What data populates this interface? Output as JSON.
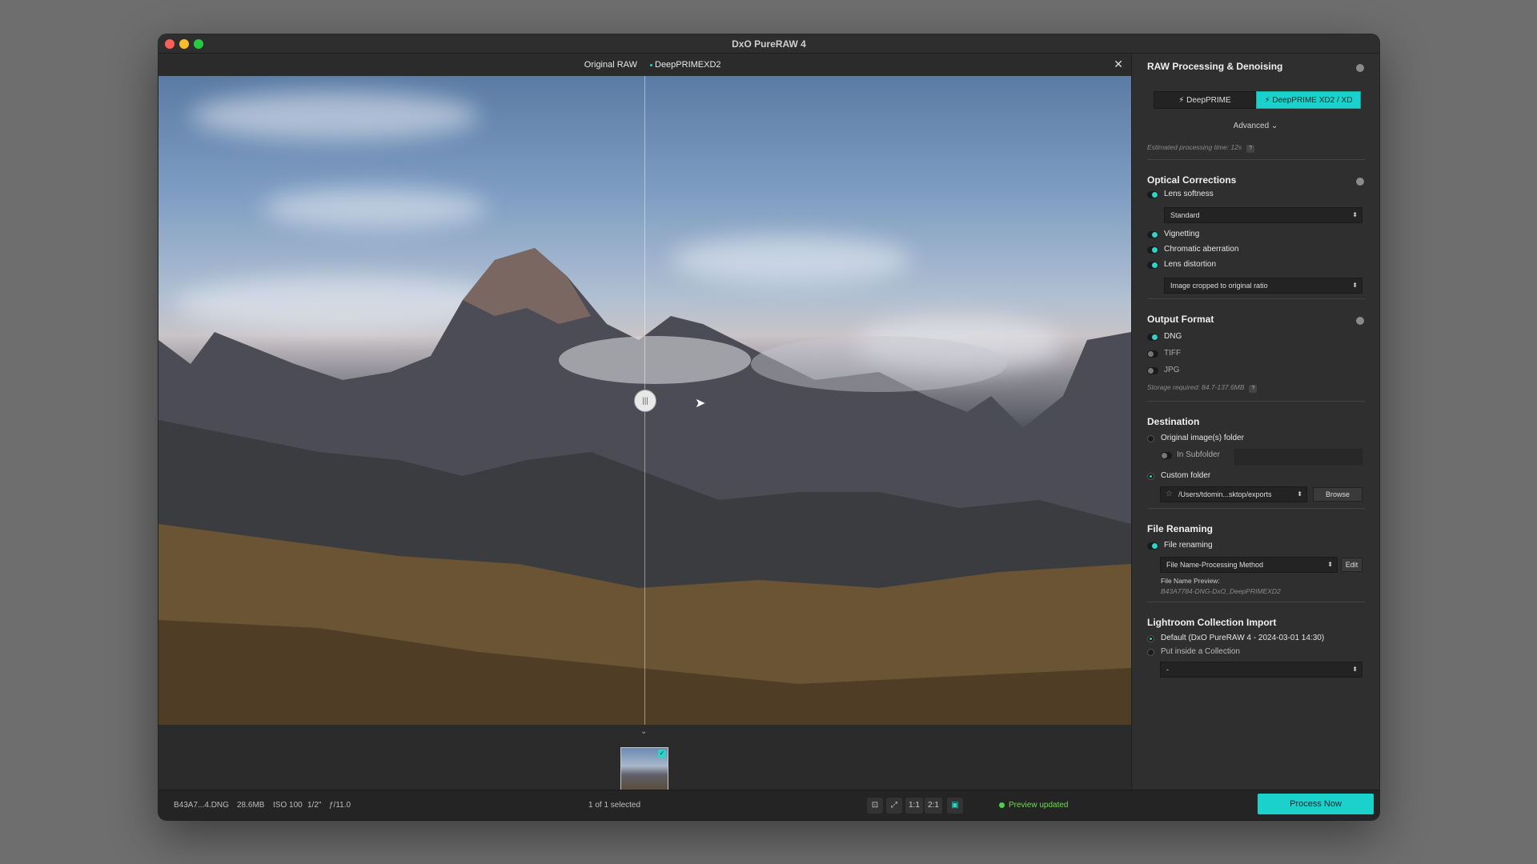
{
  "window": {
    "title": "DxO PureRAW 4"
  },
  "viewer": {
    "compare_left": "Original RAW",
    "compare_right": "DeepPRIMEXD2",
    "close_glyph": "✕",
    "handle_glyph": "|||",
    "expand_glyph": "⌄"
  },
  "filmstrip": {
    "check_glyph": "✓"
  },
  "status": {
    "filename": "B43A7...4.DNG",
    "filesize": "28.6MB",
    "iso": "ISO 100",
    "shutter": "1/2\"",
    "aperture": "ƒ/11.0",
    "selection": "1 of 1 selected",
    "zoom_1": "1:1",
    "zoom_2": "2:1",
    "preview": "Preview updated",
    "process_button": "Process Now"
  },
  "panel": {
    "raw": {
      "title": "RAW Processing & Denoising",
      "seg_off": "⚡ DeepPRIME",
      "seg_on": "⚡ DeepPRIME XD2 / XD",
      "advanced": "Advanced ⌄",
      "estimate": "Estimated processing time:  12s"
    },
    "optical": {
      "title": "Optical Corrections",
      "lens_softness": "Lens softness",
      "softness_value": "Standard",
      "vignetting": "Vignetting",
      "chromatic": "Chromatic aberration",
      "distortion": "Lens distortion",
      "distortion_value": "Image cropped to original ratio"
    },
    "output": {
      "title": "Output Format",
      "dng": "DNG",
      "tiff": "TIFF",
      "jpg": "JPG",
      "storage": "Storage required: 84.7-137.6MB"
    },
    "destination": {
      "title": "Destination",
      "original_folder": "Original image(s) folder",
      "subfolder": "In Subfolder",
      "custom_folder": "Custom folder",
      "path": "/Users/tdomin...sktop/exports",
      "browse": "Browse"
    },
    "renaming": {
      "title": "File Renaming",
      "toggle_label": "File renaming",
      "pattern": "File Name-Processing Method",
      "edit": "Edit",
      "preview_label": "File Name Preview:",
      "preview_value": "B43A7784-DNG-DxO_DeepPRIMEXD2"
    },
    "lightroom": {
      "title": "Lightroom Collection Import",
      "default": "Default (DxO PureRAW 4 - 2024-03-01 14:30)",
      "inside": "Put inside a Collection",
      "collection_value": "-"
    }
  },
  "colors": {
    "accent": "#1ad1cb",
    "status_green": "#4fd049"
  }
}
